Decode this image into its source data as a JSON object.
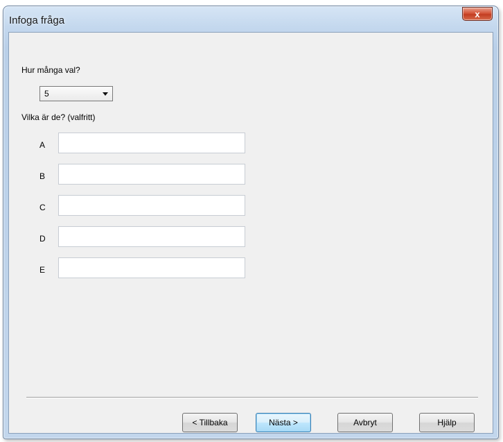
{
  "window": {
    "title": "Infoga fråga",
    "close_label": "x"
  },
  "form": {
    "count_question": "Hur många val?",
    "count_value": "5",
    "which_question": "Vilka är de? (valfritt)",
    "rows": [
      {
        "letter": "A",
        "value": ""
      },
      {
        "letter": "B",
        "value": ""
      },
      {
        "letter": "C",
        "value": ""
      },
      {
        "letter": "D",
        "value": ""
      },
      {
        "letter": "E",
        "value": ""
      }
    ]
  },
  "buttons": {
    "back": "< Tillbaka",
    "next": "Nästa >",
    "cancel": "Avbryt",
    "help": "Hjälp"
  }
}
